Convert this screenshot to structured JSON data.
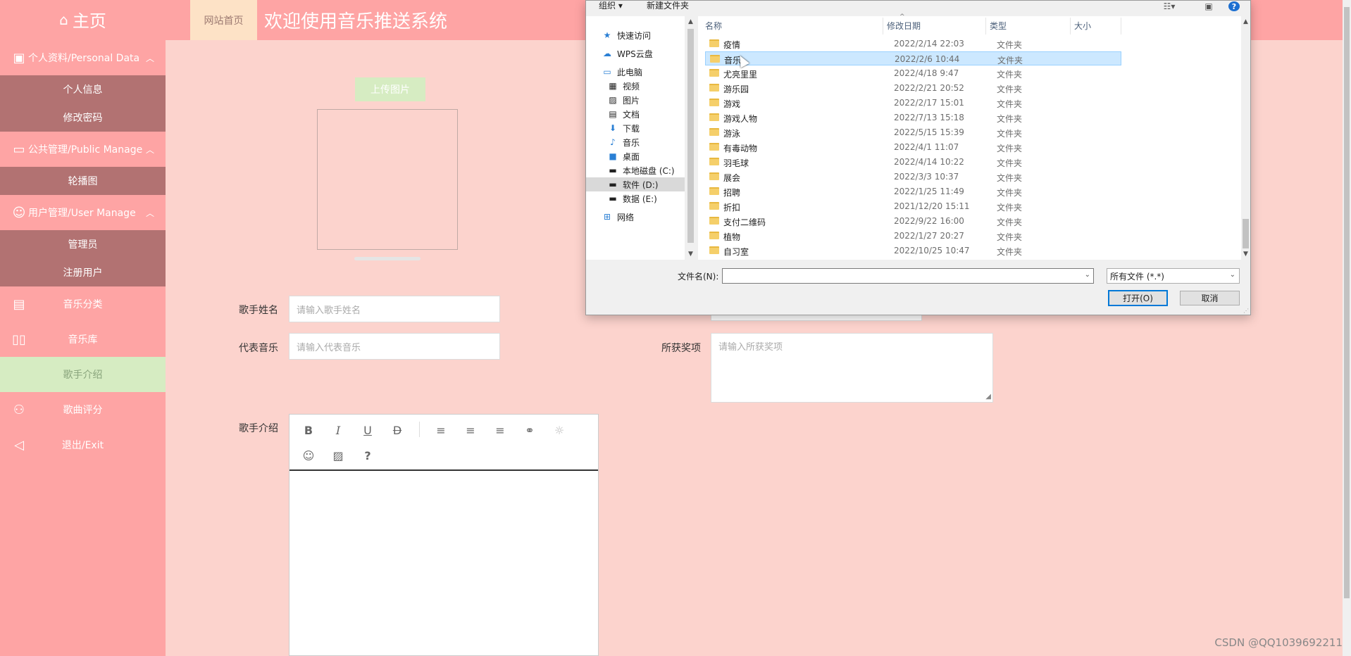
{
  "sidebar": {
    "logo": "主页",
    "sections": [
      {
        "title": "个人资料/Personal Data",
        "items": [
          "个人信息",
          "修改密码"
        ]
      },
      {
        "title": "公共管理/Public Manage",
        "items": [
          "轮播图"
        ]
      },
      {
        "title": "用户管理/User Manage",
        "items": [
          "管理员",
          "注册用户"
        ]
      }
    ],
    "simple_items": [
      {
        "label": "音乐分类"
      },
      {
        "label": "音乐库"
      },
      {
        "label": "歌手介绍"
      },
      {
        "label": "歌曲评分"
      },
      {
        "label": "退出/Exit"
      }
    ],
    "active_color": "#d6ecc2"
  },
  "header": {
    "home_tab": "网站首页",
    "title": "欢迎使用音乐推送系统"
  },
  "form": {
    "upload_label": "上传图片",
    "singer_name_label": "歌手姓名",
    "singer_name_placeholder": "请输入歌手姓名",
    "rep_music_label": "代表音乐",
    "rep_music_placeholder": "请输入代表音乐",
    "awards_label": "所获奖项",
    "awards_placeholder": "请输入所获奖项",
    "intro_label": "歌手介绍"
  },
  "watermark": "CSDN @QQ1039692211",
  "dialog": {
    "toolbar": {
      "organize": "组织",
      "new_folder": "新建文件夹"
    },
    "nav": [
      {
        "label": "快速访问",
        "icon": "star-icon"
      },
      {
        "label": "WPS云盘",
        "icon": "cloud-icon"
      },
      {
        "label": "此电脑",
        "icon": "computer-icon"
      },
      {
        "label": "视频",
        "icon": "video-icon"
      },
      {
        "label": "图片",
        "icon": "picture-icon"
      },
      {
        "label": "文档",
        "icon": "document-icon"
      },
      {
        "label": "下载",
        "icon": "download-icon"
      },
      {
        "label": "音乐",
        "icon": "music-icon"
      },
      {
        "label": "桌面",
        "icon": "desktop-icon"
      },
      {
        "label": "本地磁盘 (C:)",
        "icon": "drive-icon"
      },
      {
        "label": "软件 (D:)",
        "icon": "drive-icon"
      },
      {
        "label": "数据 (E:)",
        "icon": "drive-icon"
      },
      {
        "label": "网络",
        "icon": "network-icon"
      }
    ],
    "columns": {
      "name": "名称",
      "date": "修改日期",
      "type": "类型",
      "size": "大小"
    },
    "files": [
      {
        "name": "疫情",
        "date": "2022/2/14 22:03",
        "type": "文件夹"
      },
      {
        "name": "音乐",
        "date": "2022/2/6 10:44",
        "type": "文件夹"
      },
      {
        "name": "尤亮里里",
        "date": "2022/4/18 9:47",
        "type": "文件夹"
      },
      {
        "name": "游乐园",
        "date": "2022/2/21 20:52",
        "type": "文件夹"
      },
      {
        "name": "游戏",
        "date": "2022/2/17 15:01",
        "type": "文件夹"
      },
      {
        "name": "游戏人物",
        "date": "2022/7/13 15:18",
        "type": "文件夹"
      },
      {
        "name": "游泳",
        "date": "2022/5/15 15:39",
        "type": "文件夹"
      },
      {
        "name": "有毒动物",
        "date": "2022/4/1 11:07",
        "type": "文件夹"
      },
      {
        "name": "羽毛球",
        "date": "2022/4/14 10:22",
        "type": "文件夹"
      },
      {
        "name": "展会",
        "date": "2022/3/3 10:37",
        "type": "文件夹"
      },
      {
        "name": "招聘",
        "date": "2022/1/25 11:49",
        "type": "文件夹"
      },
      {
        "name": "折扣",
        "date": "2021/12/20 15:11",
        "type": "文件夹"
      },
      {
        "name": "支付二维码",
        "date": "2022/9/22 16:00",
        "type": "文件夹"
      },
      {
        "name": "植物",
        "date": "2022/1/27 20:27",
        "type": "文件夹"
      },
      {
        "name": "自习室",
        "date": "2022/10/25 10:47",
        "type": "文件夹"
      }
    ],
    "filename_label": "文件名(N):",
    "filename_value": "",
    "filetype": "所有文件 (*.*)",
    "open_button": "打开(O)",
    "cancel_button": "取消"
  }
}
